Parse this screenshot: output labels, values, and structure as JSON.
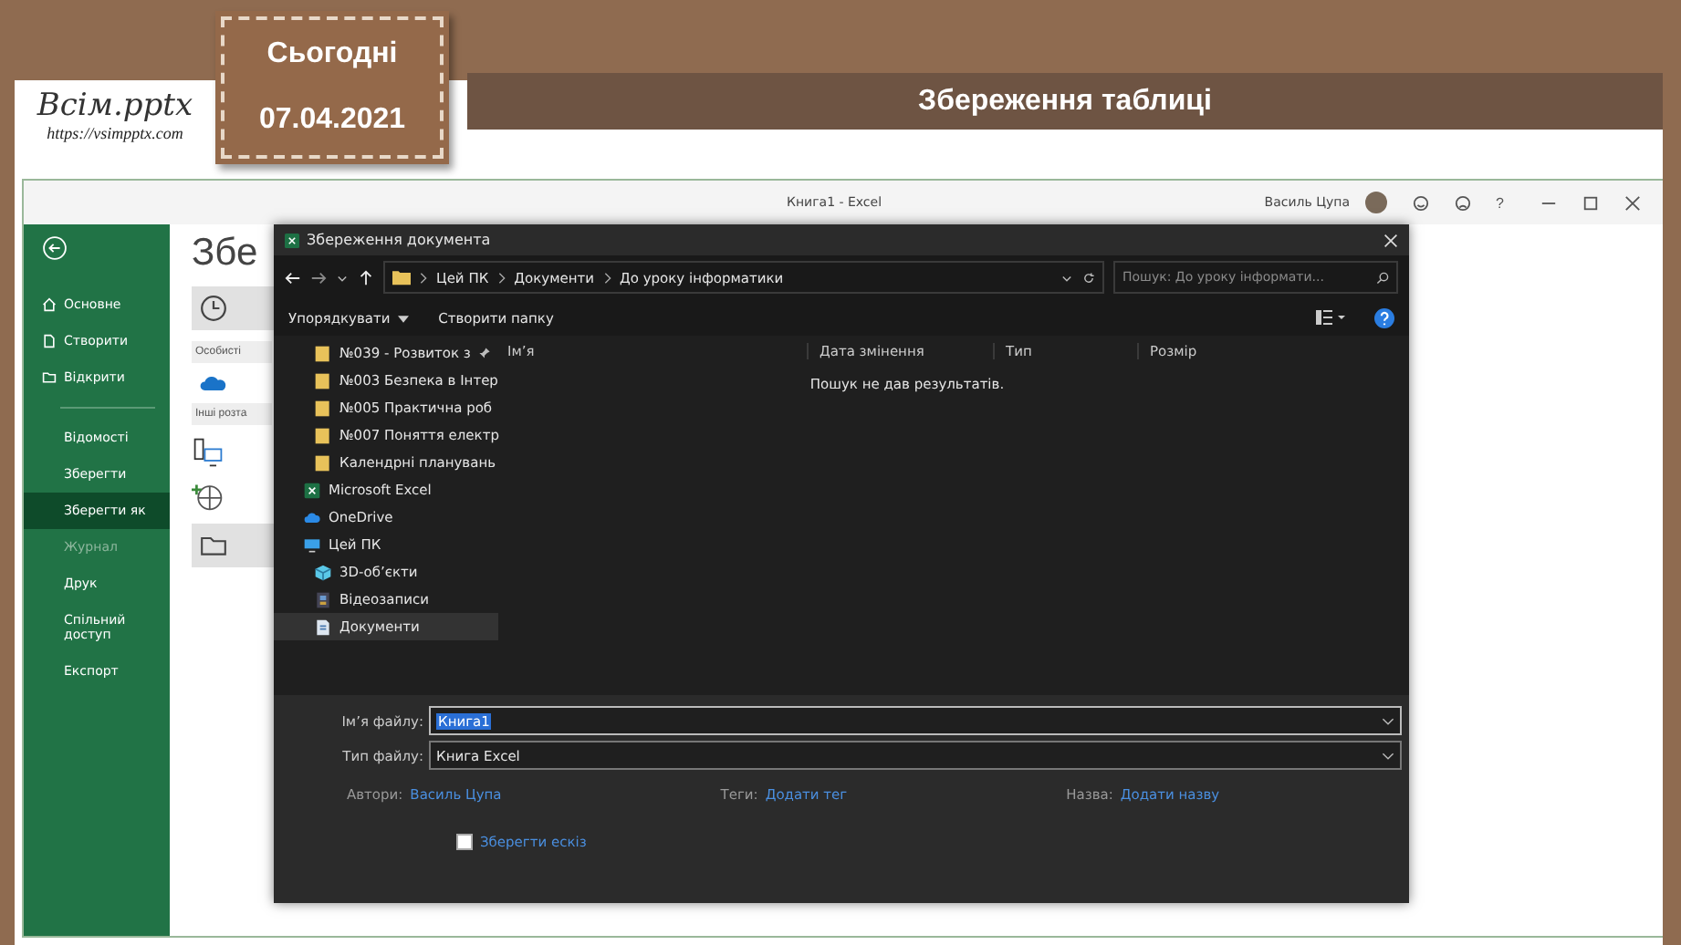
{
  "logo": {
    "title": "Всім.pptx",
    "url": "https://vsimpptx.com"
  },
  "date_tag": {
    "label": "Сьогодні",
    "date": "07.04.2021"
  },
  "slide_title": "Збереження таблиці",
  "excel": {
    "title": "Книга1  -  Excel",
    "user": "Василь Цупа",
    "help": "?"
  },
  "sidebar": {
    "top_items": [
      {
        "label": "Основне",
        "kind": "home"
      },
      {
        "label": "Створити",
        "kind": "new"
      },
      {
        "label": "Відкрити",
        "kind": "open"
      }
    ],
    "items": [
      {
        "label": "Відомості",
        "selected": false,
        "disabled": false
      },
      {
        "label": "Зберегти",
        "selected": false,
        "disabled": false
      },
      {
        "label": "Зберегти як",
        "selected": true,
        "disabled": false
      },
      {
        "label": "Журнал",
        "selected": false,
        "disabled": true
      },
      {
        "label": "Друк",
        "selected": false,
        "disabled": false
      },
      {
        "label": "Спільний доступ",
        "selected": false,
        "disabled": false
      },
      {
        "label": "Експорт",
        "selected": false,
        "disabled": false
      }
    ]
  },
  "backstage": {
    "heading": "Збе",
    "section_1": "Особисті",
    "section_2": "Інші розта"
  },
  "dialog": {
    "title": "Збереження документа",
    "path": [
      "Цей ПК",
      "Документи",
      "До уроку інформатики"
    ],
    "search": {
      "placeholder": "Пошук: До уроку інформати..."
    },
    "organize": "Упорядкувати",
    "new_folder": "Створити папку",
    "nav": [
      {
        "label": "№039 - Розвиток з",
        "kind": "folder",
        "pinned": true,
        "selected": false
      },
      {
        "label": "№003 Безпека в Інтер",
        "kind": "folder",
        "pinned": false,
        "selected": false
      },
      {
        "label": "№005 Практична роб",
        "kind": "folder",
        "pinned": false,
        "selected": false
      },
      {
        "label": "№007 Поняття електр",
        "kind": "folder",
        "pinned": false,
        "selected": false
      },
      {
        "label": "Календрні планувань",
        "kind": "folder",
        "pinned": false,
        "selected": false
      },
      {
        "label": "Microsoft Excel",
        "kind": "excel",
        "pinned": false,
        "selected": false
      },
      {
        "label": "OneDrive",
        "kind": "cloud",
        "pinned": false,
        "selected": false
      },
      {
        "label": "Цей ПК",
        "kind": "pc",
        "pinned": false,
        "selected": false,
        "children": [
          {
            "label": "3D-об’єкти",
            "kind": "cube",
            "pinned": false,
            "selected": false
          },
          {
            "label": "Відеозаписи",
            "kind": "video",
            "pinned": false,
            "selected": false
          },
          {
            "label": "Документи",
            "kind": "document",
            "pinned": false,
            "selected": true
          }
        ]
      }
    ],
    "columns": [
      "Ім’я",
      "Дата змінення",
      "Тип",
      "Розмір"
    ],
    "empty_message": "Пошук не дав результатів.",
    "file_name": {
      "label": "Ім’я файлу:",
      "value": "Книга1"
    },
    "file_type": {
      "label": "Тип файлу:",
      "value": "Книга Excel"
    },
    "meta": [
      {
        "label": "Автори:",
        "value": "Василь Цупа"
      },
      {
        "label": "Теги:",
        "value": "Додати тег"
      },
      {
        "label": "Назва:",
        "value": "Додати назву"
      }
    ],
    "thumbnail": {
      "label": "Зберегти ескіз",
      "checked": false
    }
  }
}
